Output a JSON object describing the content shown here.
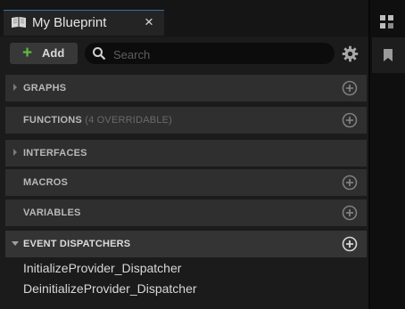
{
  "tab": {
    "title": "My Blueprint",
    "close": "×"
  },
  "toolbar": {
    "add_label": "Add",
    "search_placeholder": "Search"
  },
  "sections": [
    {
      "label": "GRAPHS",
      "sub": "",
      "has_chevron": true,
      "has_add": true
    },
    {
      "label": "FUNCTIONS",
      "sub": "(4 OVERRIDABLE)",
      "has_chevron": false,
      "has_add": true
    },
    {
      "label": "INTERFACES",
      "sub": "",
      "has_chevron": true,
      "has_add": false
    },
    {
      "label": "MACROS",
      "sub": "",
      "has_chevron": false,
      "has_add": true
    },
    {
      "label": "VARIABLES",
      "sub": "",
      "has_chevron": false,
      "has_add": true
    },
    {
      "label": "EVENT DISPATCHERS",
      "sub": "",
      "has_chevron": true,
      "expanded": true,
      "has_add": true
    }
  ],
  "event_dispatchers": [
    "InitializeProvider_Dispatcher",
    "DeinitializeProvider_Dispatcher"
  ],
  "colors": {
    "accent_blue": "#3a6ea8",
    "add_green": "#5fbf3f"
  }
}
